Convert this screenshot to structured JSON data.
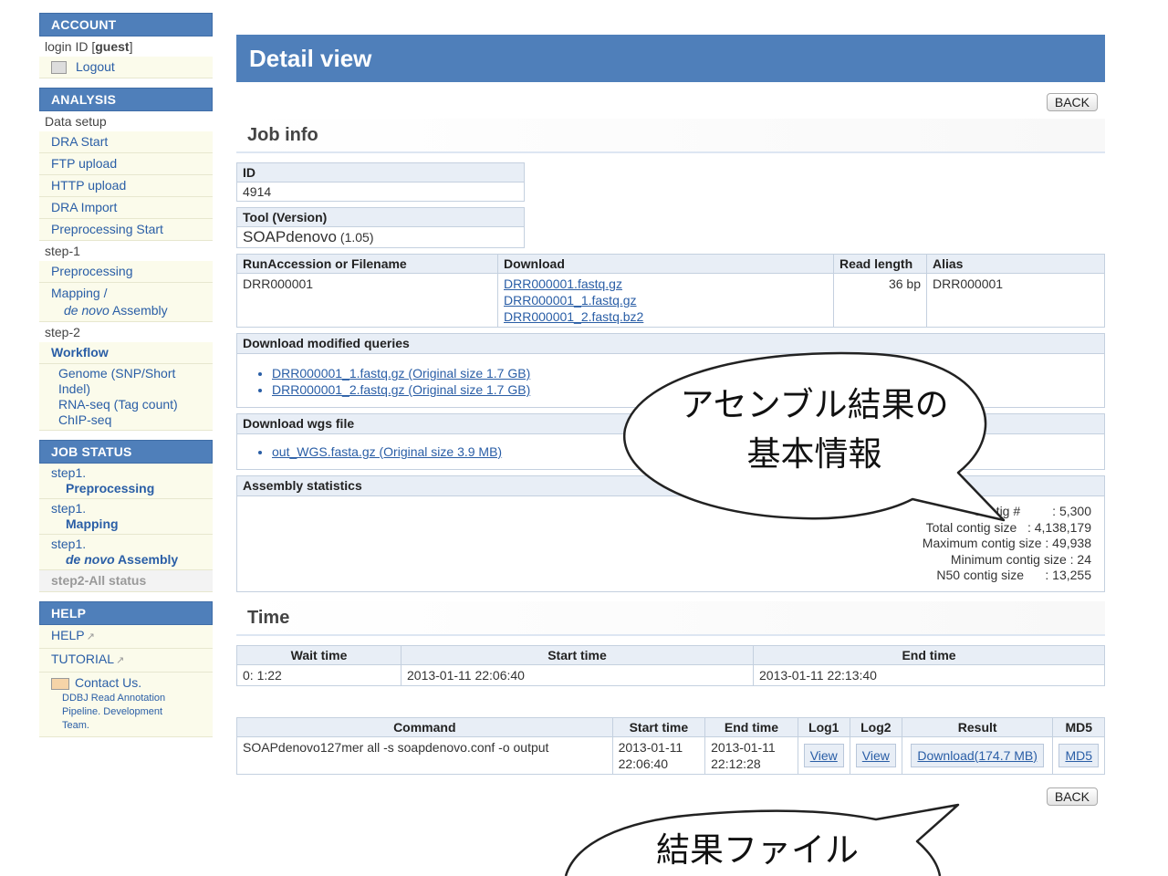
{
  "sidebar": {
    "account": {
      "title": "ACCOUNT",
      "login_prefix": "login ID [",
      "login_user": "guest",
      "login_suffix": "]",
      "logout": "Logout"
    },
    "analysis": {
      "title": "ANALYSIS",
      "data_setup": "Data setup",
      "data_setup_items": [
        "DRA Start",
        "FTP upload",
        "HTTP upload",
        "DRA Import",
        "Preprocessing Start"
      ],
      "step1": "step-1",
      "step1_items": [
        "Preprocessing"
      ],
      "mapping_line1": "Mapping /",
      "mapping_line2_italic": "de novo",
      "mapping_line2_rest": " Assembly",
      "step2": "step-2",
      "workflow": "Workflow",
      "workflow_items": [
        "Genome (SNP/Short Indel)",
        "RNA-seq (Tag count)",
        "ChIP-seq"
      ]
    },
    "job_status": {
      "title": "JOB STATUS",
      "items": [
        {
          "step": "step1.",
          "name": "Preprocessing"
        },
        {
          "step": "step1.",
          "name": "Mapping"
        },
        {
          "step": "step1.",
          "name_italic": "de novo",
          "name_rest": " Assembly"
        }
      ],
      "all_status": "step2-All status"
    },
    "help": {
      "title": "HELP",
      "help": "HELP",
      "tutorial": "TUTORIAL",
      "contact": "Contact Us.",
      "contact_note": "DDBJ Read Annotation Pipeline. Development Team."
    }
  },
  "main": {
    "title": "Detail view",
    "back": "BACK",
    "job_info": {
      "title": "Job info",
      "id_label": "ID",
      "id_value": "4914",
      "tool_label": "Tool (Version)",
      "tool_name": "SOAPdenovo",
      "tool_version": " (1.05)"
    },
    "run_table": {
      "headers": [
        "RunAccession or Filename",
        "Download",
        "Read length",
        "Alias"
      ],
      "row": {
        "run": "DRR000001",
        "downloads": [
          "DRR000001.fastq.gz",
          "DRR000001_1.fastq.gz",
          "DRR000001_2.fastq.bz2"
        ],
        "read_length": "36 bp",
        "alias": "DRR000001"
      }
    },
    "modified_queries": {
      "title": "Download modified queries",
      "links": [
        "DRR000001_1.fastq.gz (Original size 1.7 GB)",
        "DRR000001_2.fastq.gz (Original size 1.7 GB)"
      ]
    },
    "wgs": {
      "title": "Download wgs file",
      "links": [
        "out_WGS.fasta.gz (Original size 3.9 MB)"
      ]
    },
    "assembly": {
      "title": "Assembly statistics",
      "stats": [
        {
          "key": "Contig #",
          "value": ": 5,300"
        },
        {
          "key": "Total contig size",
          "value": ": 4,138,179"
        },
        {
          "key": "Maximum contig size",
          "value": ": 49,938"
        },
        {
          "key": "Minimum contig size",
          "value": ": 24"
        },
        {
          "key": "N50 contig size",
          "value": ": 13,255"
        }
      ]
    },
    "time": {
      "title": "Time",
      "headers": [
        "Wait time",
        "Start time",
        "End time"
      ],
      "row": [
        "0: 1:22",
        "2013-01-11 22:06:40",
        "2013-01-11 22:13:40"
      ]
    },
    "command_table": {
      "headers": [
        "Command",
        "Start time",
        "End time",
        "Log1",
        "Log2",
        "Result",
        "MD5"
      ],
      "row": {
        "command": "SOAPdenovo127mer all -s soapdenovo.conf -o output",
        "start": "2013-01-11 22:06:40",
        "end": "2013-01-11 22:12:28",
        "log1": "View",
        "log2": "View",
        "result": "Download(174.7 MB)",
        "md5": "MD5"
      }
    }
  },
  "callouts": {
    "assembly_line1": "アセンブル結果の",
    "assembly_line2": "基本情報",
    "result": "結果ファイル"
  }
}
